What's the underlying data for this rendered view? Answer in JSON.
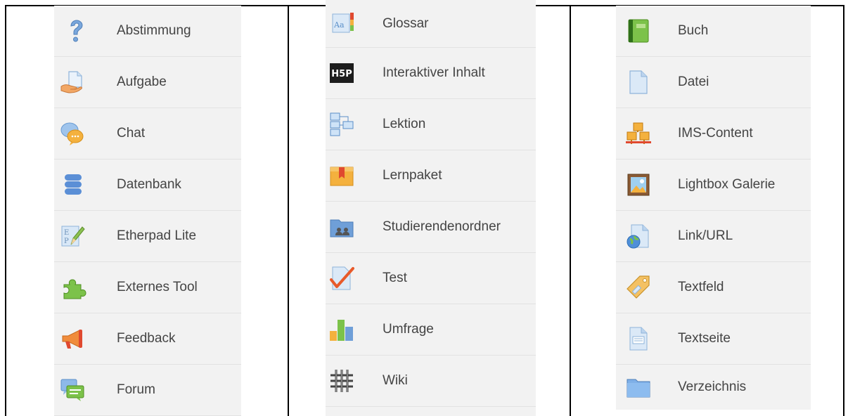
{
  "columns": [
    {
      "id": "col1",
      "items": [
        {
          "label": "Abstimmung",
          "icon": "question-mark-icon"
        },
        {
          "label": "Aufgabe",
          "icon": "assignment-hand-icon"
        },
        {
          "label": "Chat",
          "icon": "chat-bubbles-icon"
        },
        {
          "label": "Datenbank",
          "icon": "database-icon"
        },
        {
          "label": "Etherpad Lite",
          "icon": "etherpad-pencil-icon"
        },
        {
          "label": "Externes Tool",
          "icon": "puzzle-icon"
        },
        {
          "label": "Feedback",
          "icon": "megaphone-icon"
        },
        {
          "label": "Forum",
          "icon": "forum-bubbles-icon"
        }
      ]
    },
    {
      "id": "col2",
      "items": [
        {
          "label": "Glossar",
          "icon": "glossary-icon"
        },
        {
          "label": "Interaktiver Inhalt",
          "icon": "h5p-icon",
          "icon_text": "H5P"
        },
        {
          "label": "Lektion",
          "icon": "lesson-flow-icon"
        },
        {
          "label": "Lernpaket",
          "icon": "package-box-icon"
        },
        {
          "label": "Studierendenordner",
          "icon": "student-folder-icon"
        },
        {
          "label": "Test",
          "icon": "quiz-check-icon"
        },
        {
          "label": "Umfrage",
          "icon": "survey-bars-icon"
        },
        {
          "label": "Wiki",
          "icon": "wiki-knot-icon"
        }
      ]
    },
    {
      "id": "col3",
      "items": [
        {
          "label": "Buch",
          "icon": "book-icon"
        },
        {
          "label": "Datei",
          "icon": "file-icon"
        },
        {
          "label": "IMS-Content",
          "icon": "ims-boxes-icon"
        },
        {
          "label": "Lightbox Galerie",
          "icon": "gallery-picture-icon"
        },
        {
          "label": "Link/URL",
          "icon": "url-globe-icon"
        },
        {
          "label": "Textfeld",
          "icon": "label-tag-icon"
        },
        {
          "label": "Textseite",
          "icon": "text-page-icon"
        },
        {
          "label": "Verzeichnis",
          "icon": "folder-icon"
        }
      ]
    }
  ],
  "colors": {
    "panel_bg": "#f2f2f2",
    "separator": "#e2e2e2",
    "frame": "#000000",
    "label_text": "#444444"
  }
}
